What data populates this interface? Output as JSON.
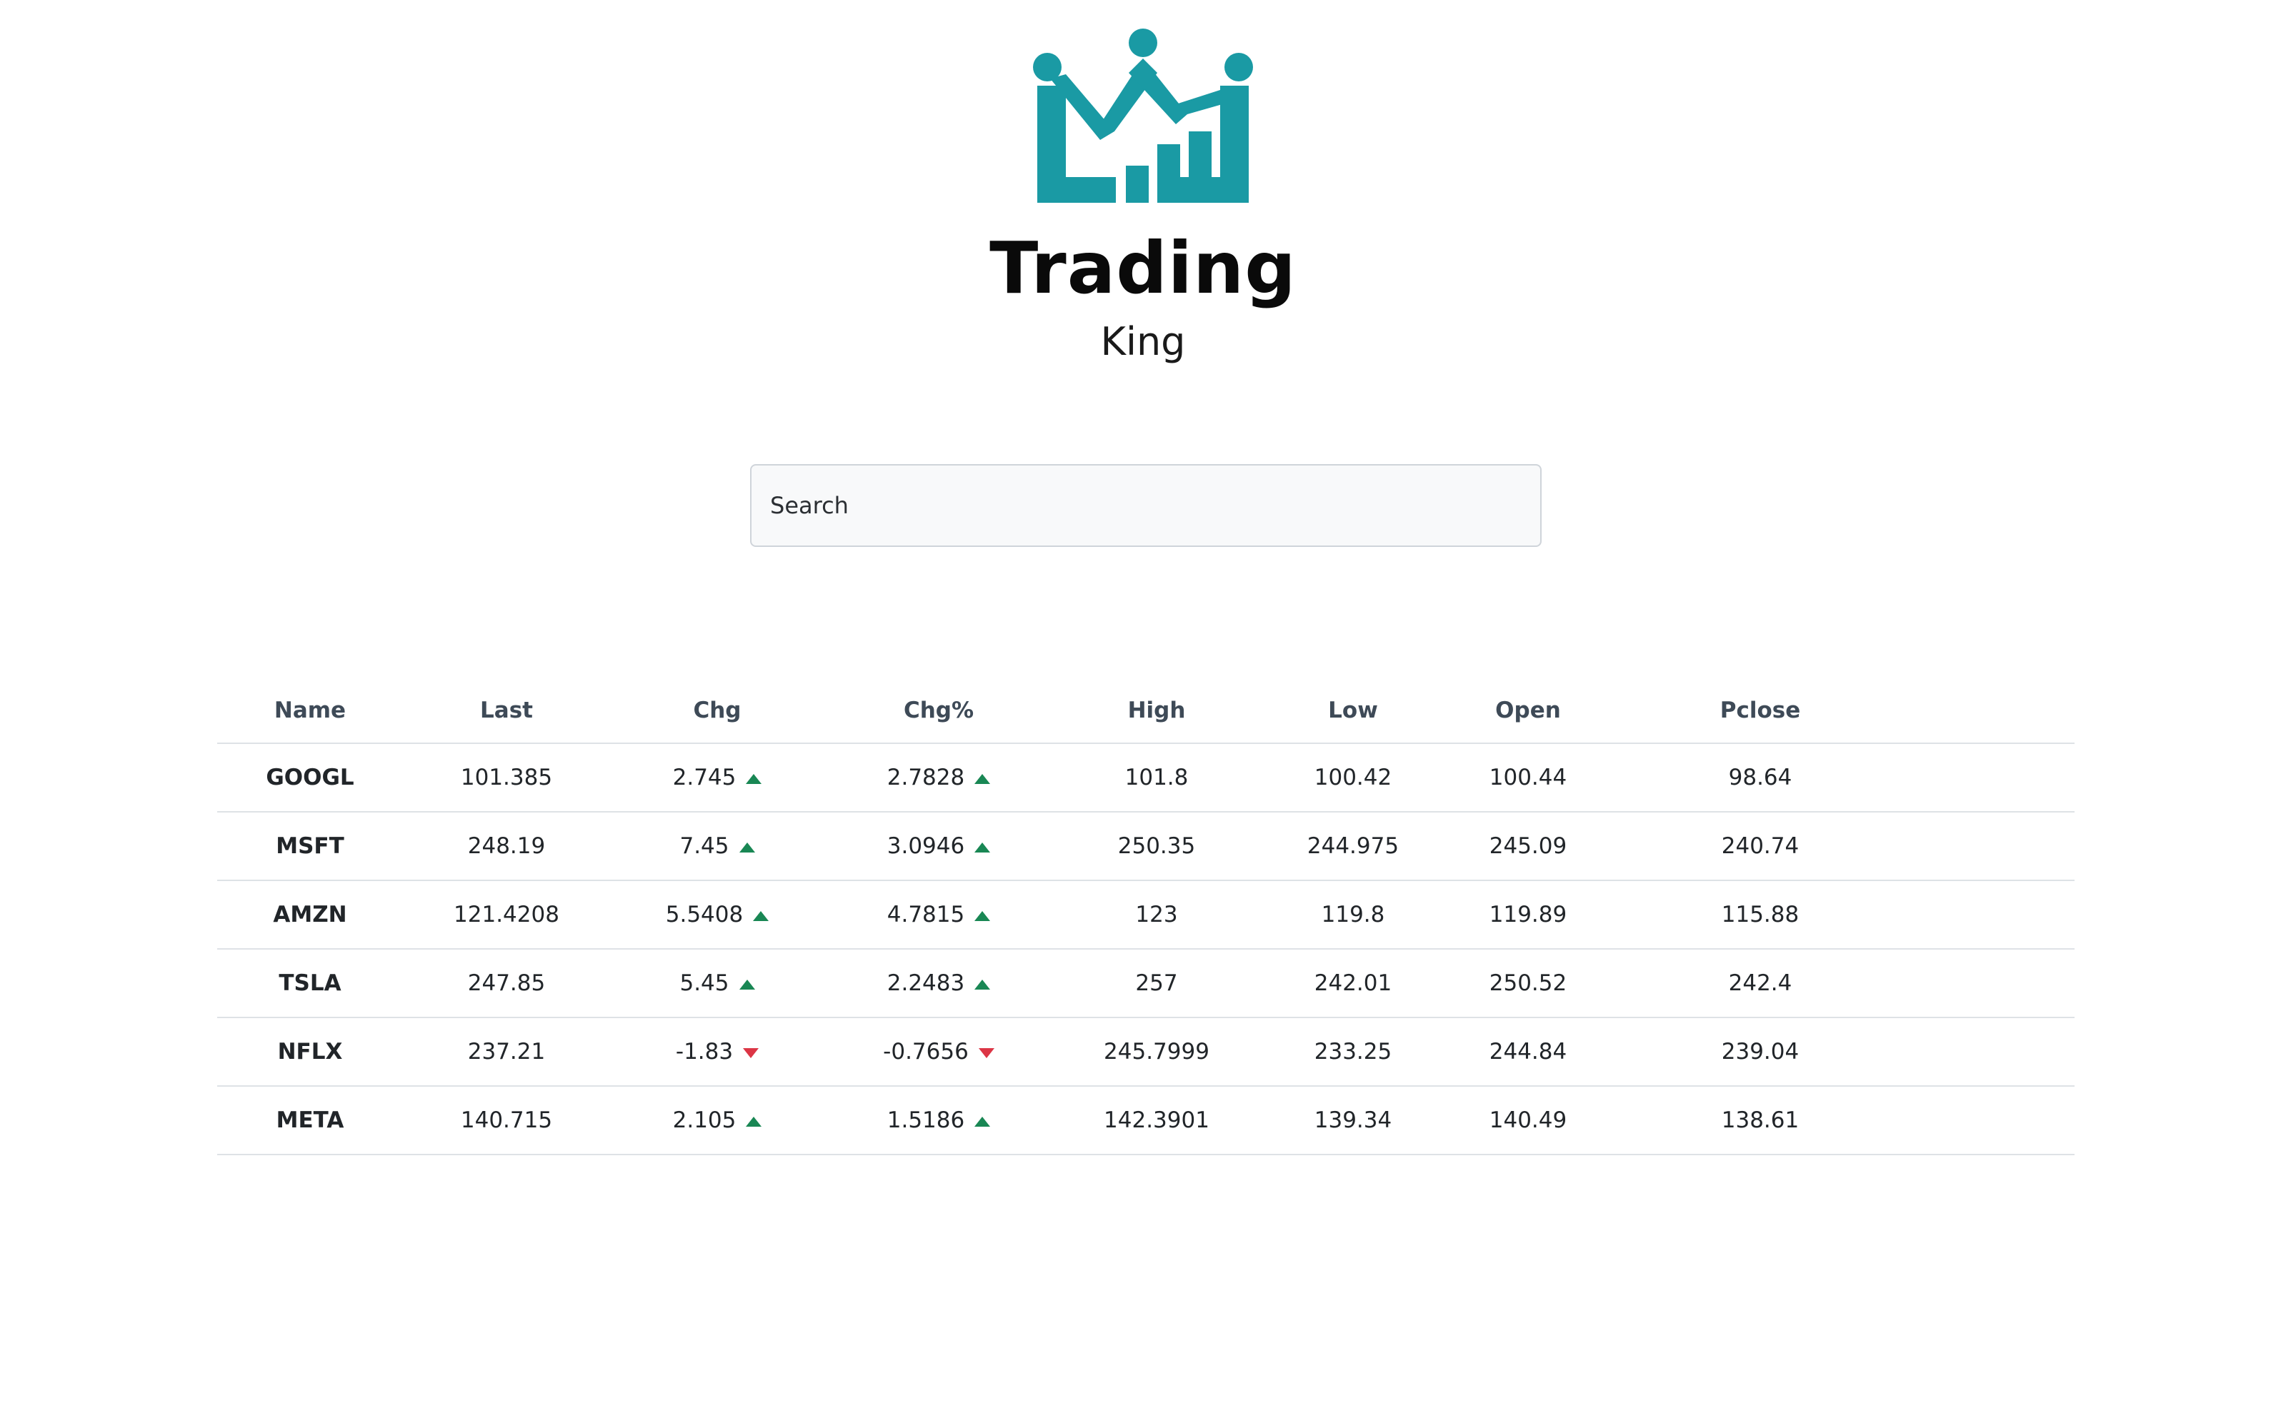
{
  "brand": {
    "title": "Trading",
    "subtitle": "King",
    "logo_color": "#1a9aa4"
  },
  "search": {
    "placeholder": "Search",
    "value": ""
  },
  "table": {
    "headers": [
      "Name",
      "Last",
      "Chg",
      "Chg%",
      "High",
      "Low",
      "Open",
      "Pclose"
    ],
    "rows": [
      {
        "name": "GOOGL",
        "last": "101.385",
        "chg": "2.745",
        "chg_pct": "2.7828",
        "direction": "up",
        "high": "101.8",
        "low": "100.42",
        "open": "100.44",
        "pclose": "98.64"
      },
      {
        "name": "MSFT",
        "last": "248.19",
        "chg": "7.45",
        "chg_pct": "3.0946",
        "direction": "up",
        "high": "250.35",
        "low": "244.975",
        "open": "245.09",
        "pclose": "240.74"
      },
      {
        "name": "AMZN",
        "last": "121.4208",
        "chg": "5.5408",
        "chg_pct": "4.7815",
        "direction": "up",
        "high": "123",
        "low": "119.8",
        "open": "119.89",
        "pclose": "115.88"
      },
      {
        "name": "TSLA",
        "last": "247.85",
        "chg": "5.45",
        "chg_pct": "2.2483",
        "direction": "up",
        "high": "257",
        "low": "242.01",
        "open": "250.52",
        "pclose": "242.4"
      },
      {
        "name": "NFLX",
        "last": "237.21",
        "chg": "-1.83",
        "chg_pct": "-0.7656",
        "direction": "down",
        "high": "245.7999",
        "low": "233.25",
        "open": "244.84",
        "pclose": "239.04"
      },
      {
        "name": "META",
        "last": "140.715",
        "chg": "2.105",
        "chg_pct": "1.5186",
        "direction": "up",
        "high": "142.3901",
        "low": "139.34",
        "open": "140.49",
        "pclose": "138.61"
      }
    ]
  },
  "colors": {
    "positive": "#198754",
    "negative": "#dc3545",
    "border": "#dee2e6"
  },
  "icons": {
    "up": "caret-up-icon",
    "down": "caret-down-icon",
    "logo": "crown-chart-logo"
  }
}
